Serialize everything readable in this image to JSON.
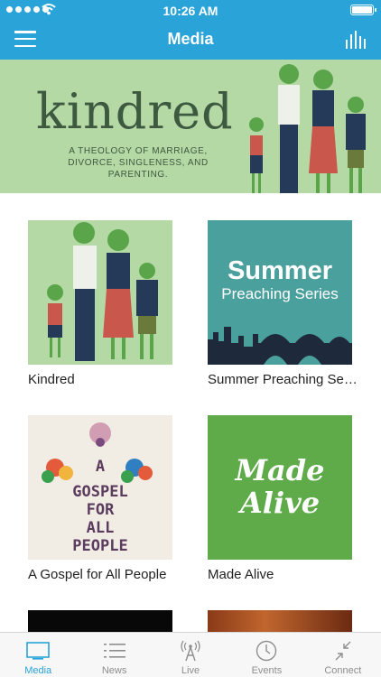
{
  "status_bar": {
    "time": "10:26 AM"
  },
  "navbar": {
    "title": "Media"
  },
  "banner": {
    "title": "kindred",
    "subtitle": "A THEOLOGY OF MARRIAGE, DIVORCE, SINGLENESS, AND PARENTING."
  },
  "grid": {
    "items": [
      {
        "label": "Kindred"
      },
      {
        "label": "Summer Preaching Series",
        "art_line1": "Summer",
        "art_line2": "Preaching Series"
      },
      {
        "label": "A Gospel for All People",
        "art_lines": [
          "A",
          "GOSPEL",
          "FOR",
          "ALL",
          "PEOPLE"
        ]
      },
      {
        "label": "Made Alive",
        "art_line1": "Made",
        "art_line2": "Alive"
      }
    ]
  },
  "tabbar": {
    "tabs": [
      {
        "label": "Media",
        "icon": "monitor-icon",
        "active": true
      },
      {
        "label": "News",
        "icon": "list-icon"
      },
      {
        "label": "Live",
        "icon": "broadcast-tower-icon"
      },
      {
        "label": "Events",
        "icon": "clock-icon"
      },
      {
        "label": "Connect",
        "icon": "collapse-arrows-icon"
      }
    ]
  },
  "colors": {
    "accent": "#2aa3d8",
    "banner_green": "#b4d9a5",
    "summer_teal": "#4aa09c",
    "made_alive_green": "#5faa49"
  }
}
